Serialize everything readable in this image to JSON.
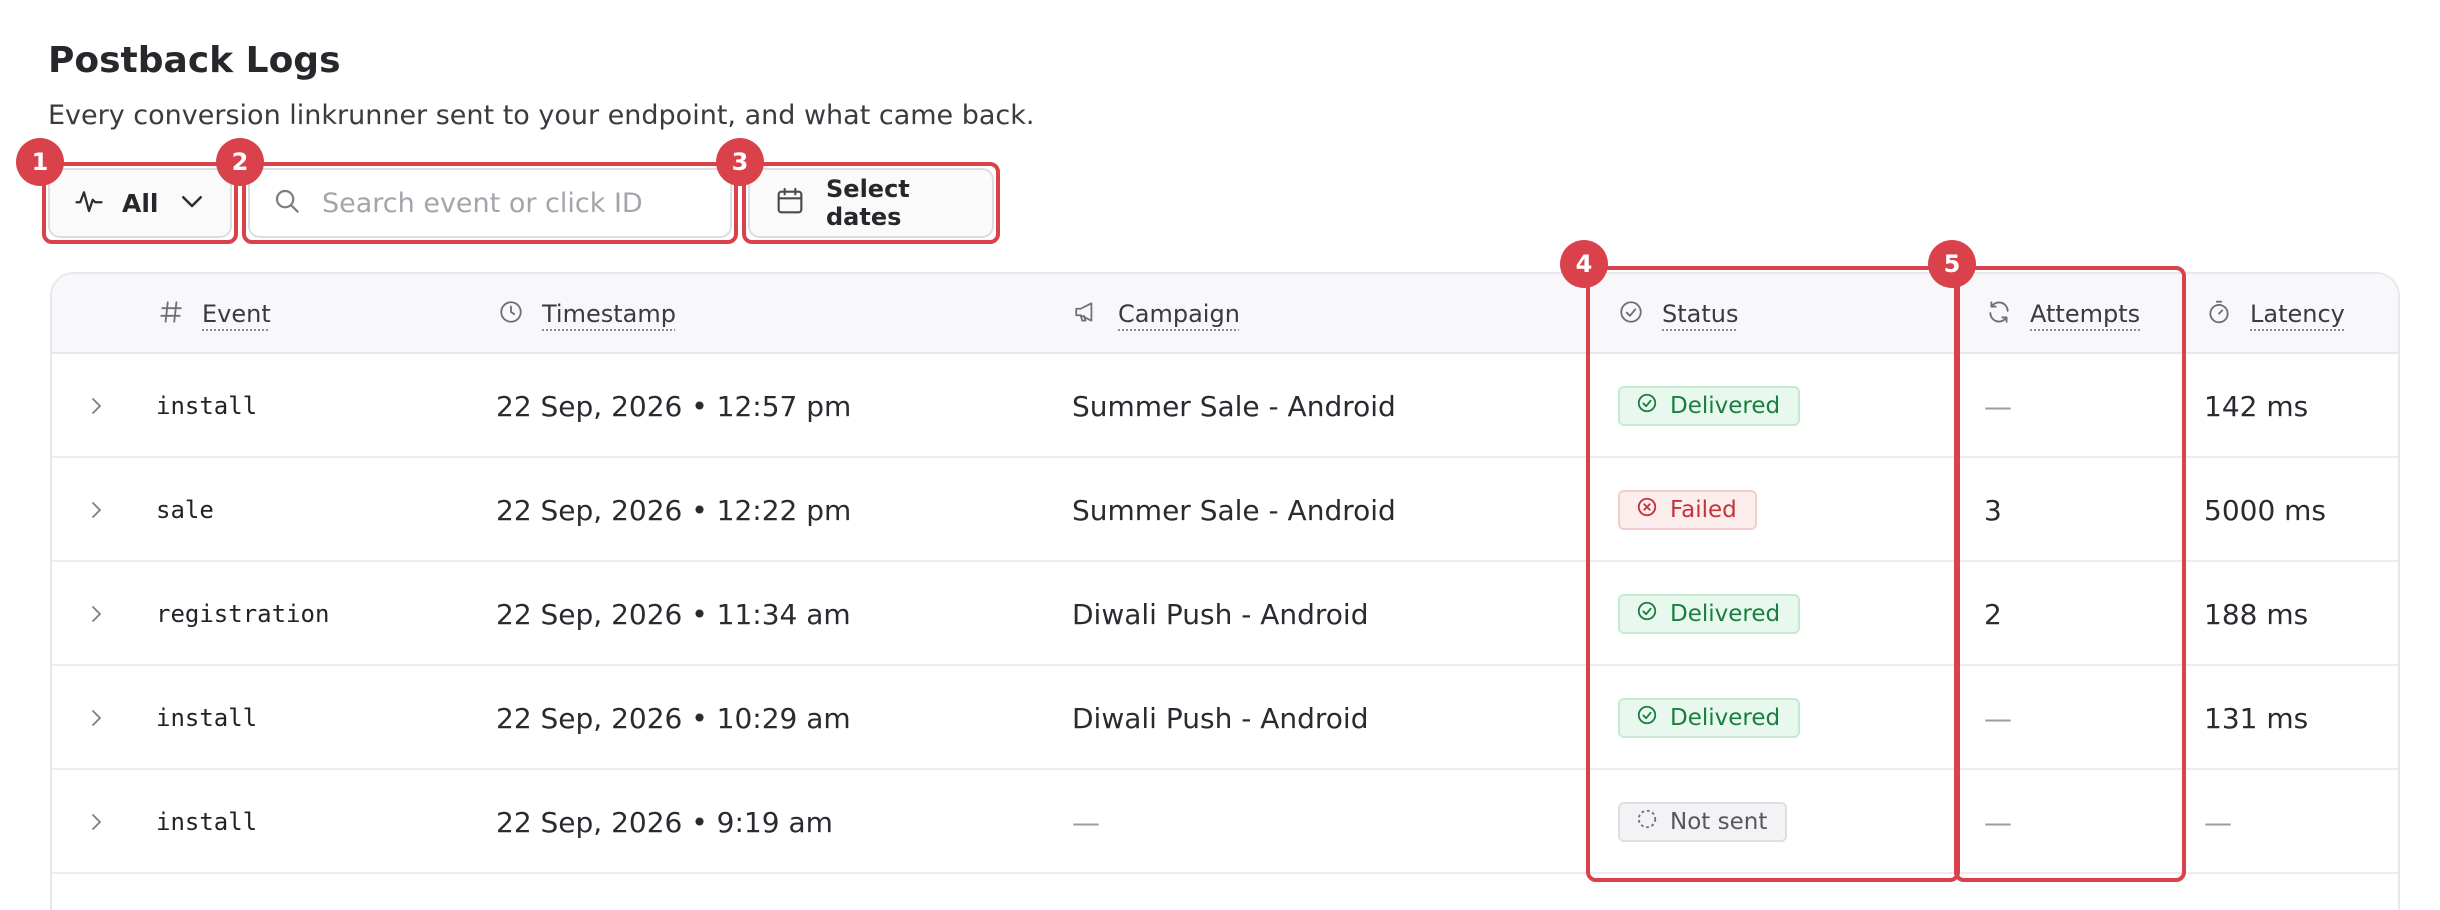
{
  "page": {
    "title": "Postback Logs",
    "subtitle": "Every conversion linkrunner sent to your endpoint, and what came back."
  },
  "filters": {
    "type_label": "All",
    "search_placeholder": "Search event or click ID",
    "date_label": "Select dates"
  },
  "table": {
    "columns": {
      "event": "Event",
      "timestamp": "Timestamp",
      "campaign": "Campaign",
      "status": "Status",
      "attempts": "Attempts",
      "latency": "Latency"
    },
    "rows": [
      {
        "event": "install",
        "timestamp": "22 Sep, 2026 • 12:57 pm",
        "campaign": "Summer Sale - Android",
        "status": "Delivered",
        "attempts": "—",
        "latency": "142 ms"
      },
      {
        "event": "sale",
        "timestamp": "22 Sep, 2026 • 12:22 pm",
        "campaign": "Summer Sale - Android",
        "status": "Failed",
        "attempts": "3",
        "latency": "5000 ms"
      },
      {
        "event": "registration",
        "timestamp": "22 Sep, 2026 • 11:34 am",
        "campaign": "Diwali Push - Android",
        "status": "Delivered",
        "attempts": "2",
        "latency": "188 ms"
      },
      {
        "event": "install",
        "timestamp": "22 Sep, 2026 • 10:29 am",
        "campaign": "Diwali Push - Android",
        "status": "Delivered",
        "attempts": "—",
        "latency": "131 ms"
      },
      {
        "event": "install",
        "timestamp": "22 Sep, 2026 • 9:19 am",
        "campaign": "—",
        "status": "Not sent",
        "attempts": "—",
        "latency": "—"
      }
    ]
  },
  "annotations": {
    "markers": [
      "1",
      "2",
      "3",
      "4",
      "5"
    ]
  },
  "colors": {
    "annotation": "#d9424b",
    "delivered": "#17803d",
    "failed": "#c4323a",
    "not_sent": "#55575d"
  },
  "icons": {
    "type_filter": "activity-icon",
    "type_dropdown": "chevron-down-icon",
    "search": "search-icon",
    "date": "calendar-icon",
    "event_col": "hash-icon",
    "timestamp_col": "clock-icon",
    "campaign_col": "megaphone-icon",
    "status_col": "check-circle-icon",
    "attempts_col": "refresh-icon",
    "latency_col": "stopwatch-icon",
    "expand_row": "chevron-right-icon"
  }
}
